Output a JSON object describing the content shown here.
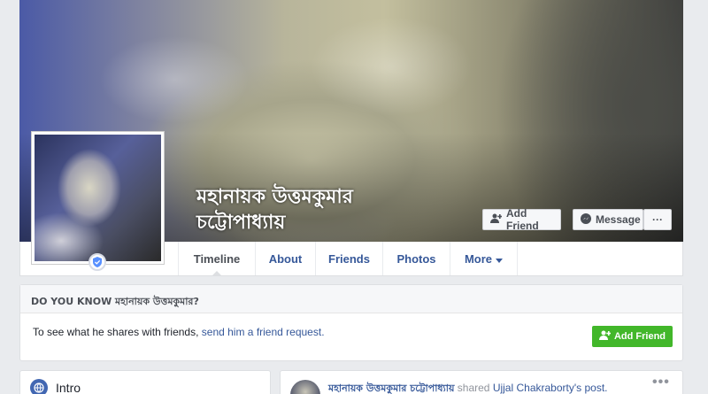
{
  "page": {
    "name": "মহানায়ক উত্তমকুমার চট্টোপাধ্যায়"
  },
  "cover_buttons": {
    "add_friend": "Add Friend",
    "message": "Message",
    "more": "···"
  },
  "tabs": [
    {
      "label": "Timeline",
      "active": true
    },
    {
      "label": "About"
    },
    {
      "label": "Friends"
    },
    {
      "label": "Photos"
    },
    {
      "label": "More"
    }
  ],
  "know_box": {
    "title": "DO YOU KNOW মহানায়ক উত্তমকুমার?",
    "text": "To see what he shares with friends,",
    "link": "send him a friend request.",
    "button": "Add Friend"
  },
  "intro": {
    "title": "Intro"
  },
  "post": {
    "author": "মহানায়ক উত্তমকুমার চট্টোপাধ্যায়",
    "verb": "shared",
    "other": "Ujjal Chakraborty's post.",
    "menu": "•••"
  },
  "colors": {
    "link": "#365899",
    "green": "#42b72a",
    "background": "#e9ebee"
  }
}
